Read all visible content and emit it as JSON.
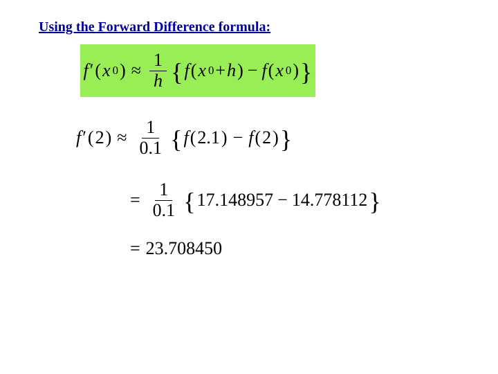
{
  "title": "Using the Forward Difference formula:",
  "formula": {
    "lhs_f": "f",
    "lhs_x": "x",
    "lhs_sub": "0",
    "approx": "≈",
    "frac_num": "1",
    "frac_den": "h",
    "f1": "f",
    "f1_arg_x": "x",
    "f1_arg_sub": "0",
    "plus": "+",
    "h": "h",
    "minus": "−",
    "f2": "f",
    "f2_arg_x": "x",
    "f2_arg_sub": "0"
  },
  "work1": {
    "lhs_f": "f",
    "lhs_arg": "2",
    "approx": "≈",
    "frac_num": "1",
    "frac_den": "0.1",
    "f1": "f",
    "f1_arg": "2.1",
    "minus": "−",
    "f2": "f",
    "f2_arg": "2"
  },
  "work2": {
    "eq": "=",
    "frac_num": "1",
    "frac_den": "0.1",
    "v1": "17.148957",
    "minus": "−",
    "v2": "14.778112"
  },
  "work3": {
    "eq": "=",
    "result": "23.708450"
  }
}
